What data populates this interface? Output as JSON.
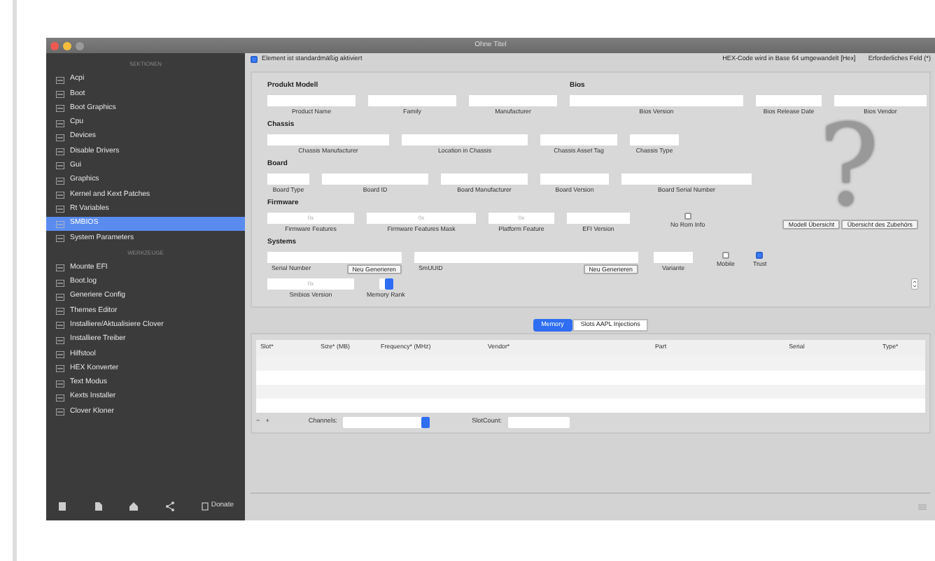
{
  "window": {
    "title": "Ohne Titel"
  },
  "sidebar": {
    "sections": [
      {
        "header": "SEKTIONEN",
        "items": [
          {
            "label": "Acpi",
            "selected": false
          },
          {
            "label": "Boot",
            "selected": false
          },
          {
            "label": "Boot Graphics",
            "selected": false
          },
          {
            "label": "Cpu",
            "selected": false
          },
          {
            "label": "Devices",
            "selected": false
          },
          {
            "label": "Disable Drivers",
            "selected": false
          },
          {
            "label": "Gui",
            "selected": false
          },
          {
            "label": "Graphics",
            "selected": false
          },
          {
            "label": "Kernel and Kext Patches",
            "selected": false
          },
          {
            "label": "Rt Variables",
            "selected": false
          },
          {
            "label": "SMBIOS",
            "selected": true
          },
          {
            "label": "System Parameters",
            "selected": false
          }
        ]
      },
      {
        "header": "WERKZEUGE",
        "items": [
          {
            "label": "Mounte EFI",
            "selected": false
          },
          {
            "label": "Boot.log",
            "selected": false
          },
          {
            "label": "Generiere Config",
            "selected": false
          },
          {
            "label": "Themes Editor",
            "selected": false
          },
          {
            "label": "Installiere/Aktualisiere Clover",
            "selected": false
          },
          {
            "label": "Installiere Treiber",
            "selected": false
          },
          {
            "label": "Hilfstool",
            "selected": false
          },
          {
            "label": "HEX Konverter",
            "selected": false
          },
          {
            "label": "Text Modus",
            "selected": false
          },
          {
            "label": "Kexts Installer",
            "selected": false
          },
          {
            "label": "Clover Kloner",
            "selected": false
          }
        ]
      }
    ],
    "toolbar_label": "Donate"
  },
  "top": {
    "enabled_check": {
      "label": "Element ist standardmäßig aktiviert",
      "checked": true
    },
    "hex_note": "HEX-Code wird in Base 64 umgewandelt [Hex]",
    "required_note": "Erforderliches Feld (*)"
  },
  "product": {
    "title": "Produkt Modell",
    "fields": [
      "Product Name",
      "Family",
      "Manufacturer"
    ]
  },
  "bios": {
    "title": "Bios",
    "fields": [
      "Bios Version",
      "Bios Release Date",
      "Bios Vendor"
    ]
  },
  "chassis": {
    "title": "Chassis",
    "fields": [
      "Chassis Manufacturer",
      "Location in Chassis",
      "Chassis Asset Tag",
      "Chassis Type"
    ]
  },
  "board": {
    "title": "Board",
    "fields": [
      "Board Type",
      "Board ID",
      "Board Manufacturer",
      "Board Version",
      "Board Serial Number"
    ]
  },
  "firmware": {
    "title": "Firmware",
    "fields": [
      {
        "label": "Firmware Features",
        "placeholder": "0x"
      },
      {
        "label": "Firmware Features Mask",
        "placeholder": "0x"
      },
      {
        "label": "Platform Feature",
        "placeholder": "0x"
      },
      {
        "label": "EFI Version"
      }
    ],
    "no_rom_info": {
      "label": "No Rom Info",
      "checked": false
    }
  },
  "model_mark": "?",
  "buttons": [
    "Modell Übersicht",
    "Übersicht des Zubehörs"
  ],
  "systems": {
    "title": "Systems",
    "serial": {
      "label": "Serial Number",
      "button": "Neu Generieren"
    },
    "smuuid": {
      "label": "SmUUID",
      "button": "Neu Generieren"
    },
    "variant": {
      "label": "Variante"
    },
    "checks": [
      {
        "label": "Mobile",
        "checked": false
      },
      {
        "label": "Trust",
        "checked": true
      }
    ],
    "smbios_version": {
      "label": "Smbios Version",
      "placeholder": "0x"
    },
    "memory_rank": {
      "label": "Memory Rank"
    }
  },
  "tabs": [
    {
      "label": "Memory",
      "selected": true
    },
    {
      "label": "Slots AAPL Injections",
      "selected": false
    }
  ],
  "table": {
    "columns": [
      "Slot*",
      "Size* (MB)",
      "Frequency* (MHz)",
      "Vendor*",
      "Part",
      "Serial",
      "Type*"
    ]
  },
  "bottom": {
    "minus": "−",
    "plus": "+",
    "channels_label": "Channels:",
    "slotcount_label": "SlotCount:"
  }
}
